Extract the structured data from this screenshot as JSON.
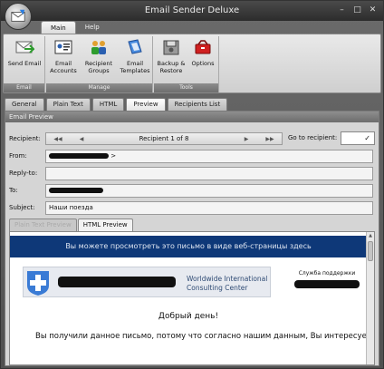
{
  "window": {
    "title": "Email Sender Deluxe"
  },
  "ribbon_tabs": [
    {
      "label": "Main",
      "active": true
    },
    {
      "label": "Help",
      "active": false
    }
  ],
  "ribbon_groups": [
    {
      "label": "Email",
      "buttons": [
        {
          "label": "Send Email",
          "icon": "send-email-icon"
        }
      ]
    },
    {
      "label": "Manage",
      "buttons": [
        {
          "label": "Email Accounts",
          "icon": "email-accounts-icon"
        },
        {
          "label": "Recipient Groups",
          "icon": "recipient-groups-icon"
        },
        {
          "label": "Email Templates",
          "icon": "email-templates-icon"
        }
      ]
    },
    {
      "label": "Tools",
      "buttons": [
        {
          "label": "Backup & Restore",
          "icon": "backup-restore-icon"
        },
        {
          "label": "Options",
          "icon": "options-icon"
        }
      ]
    }
  ],
  "doc_tabs": [
    {
      "label": "General",
      "active": false
    },
    {
      "label": "Plain Text",
      "active": false
    },
    {
      "label": "HTML",
      "active": false
    },
    {
      "label": "Preview",
      "active": true
    },
    {
      "label": "Recipients List",
      "active": false
    }
  ],
  "preview": {
    "header": "Email Preview",
    "recipient_label": "Recipient:",
    "recipient_nav": "Recipient 1 of 8",
    "goto_label": "Go to recipient:",
    "from_label": "From:",
    "from_value_suffix": ">",
    "reply_to_label": "Reply-to:",
    "to_label": "To:",
    "subject_label": "Subject:",
    "subject_value": "Наши поезда"
  },
  "preview_tabs": [
    {
      "label": "Plain Text Preview",
      "active": false
    },
    {
      "label": "HTML Preview",
      "active": true
    }
  ],
  "email_body": {
    "banner": "Вы можете просмотреть это письмо в виде веб-страницы здесь",
    "logo_line1": "Worldwide International",
    "logo_line2": "Consulting Center",
    "support": "Служба поддержки",
    "greeting": "Добрый день!",
    "line1": "Вы получили данное письмо, потому что согласно нашим данным, Вы интересуетес"
  },
  "colors": {
    "banner": "#0e3878",
    "accent_underline": "#e01010"
  }
}
